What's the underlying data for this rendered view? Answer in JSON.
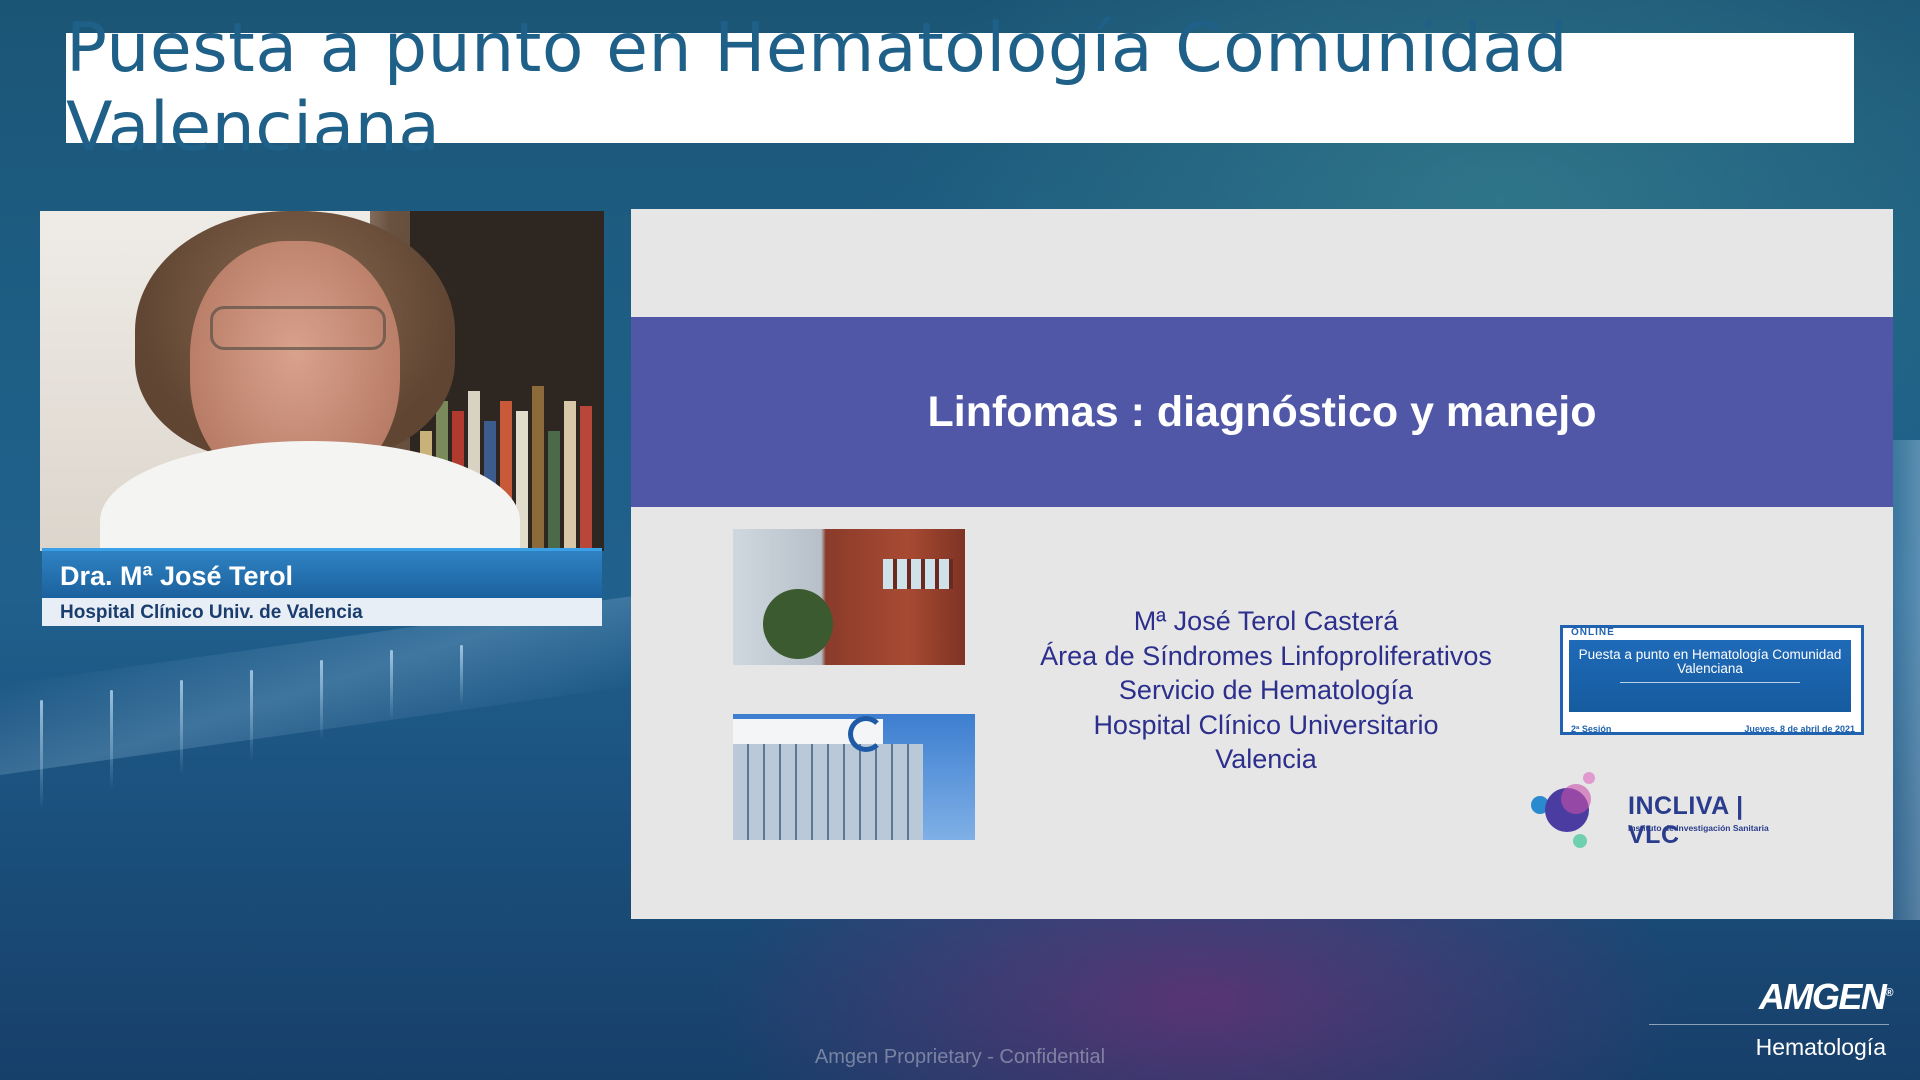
{
  "header": {
    "title": "Puesta a punto en Hematología Comunidad Valenciana"
  },
  "speaker_video": {
    "name": "Dra. Mª José Terol",
    "affiliation": "Hospital Clínico Univ. de Valencia"
  },
  "slide": {
    "title": "Linfomas : diagnóstico y manejo",
    "speaker_lines": [
      "Mª José Terol Casterá",
      "Área de Síndromes Linfoproliferativos",
      "Servicio de Hematología",
      "Hospital Clínico Universitario",
      "Valencia"
    ],
    "event_card": {
      "tag": "ONLINE",
      "title": "Puesta a punto en Hematología Comunidad Valenciana",
      "session": "2ª Sesión",
      "date": "Jueves, 8 de abril de 2021"
    },
    "institute_logo": {
      "name": "INCLIVA | VLC",
      "subtitle": "Instituto de Investigación Sanitaria"
    }
  },
  "footer": {
    "confidential": "Amgen  Proprietary - Confidential",
    "brand": "AMGEN",
    "brand_mark": "®",
    "department": "Hematología"
  },
  "colors": {
    "title_text": "#1f6088",
    "slide_band": "#4f57a6",
    "slide_text": "#2c2f8c",
    "name_bar": "#1a5f9c"
  }
}
